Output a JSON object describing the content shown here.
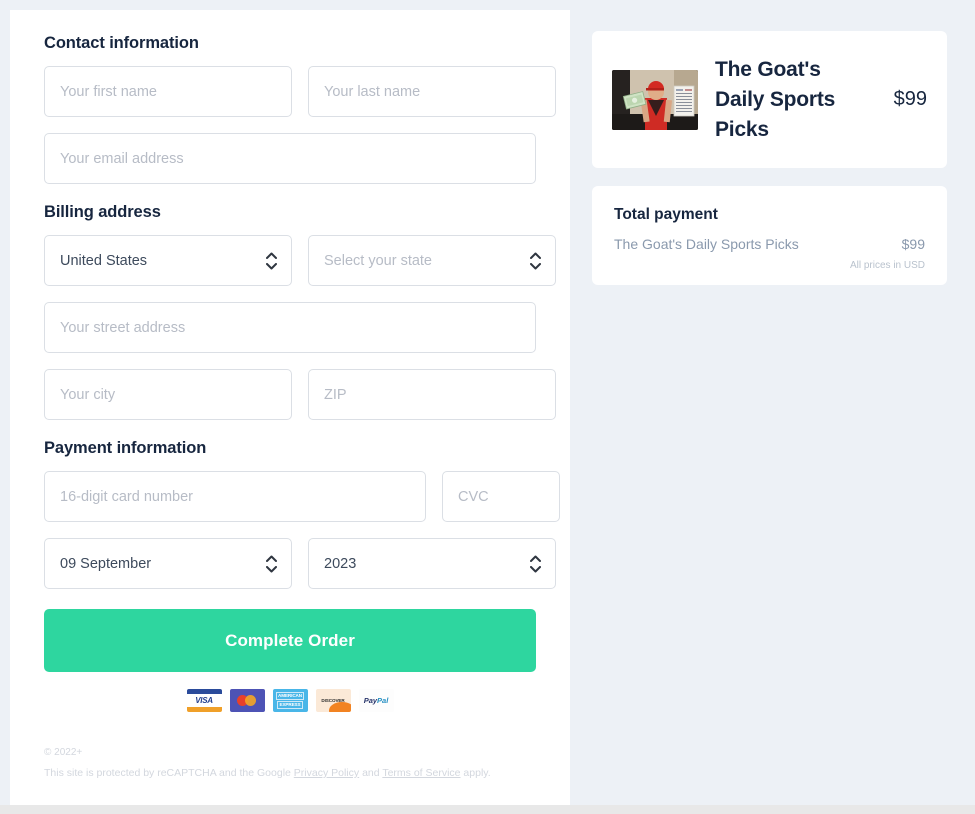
{
  "form": {
    "contact": {
      "heading": "Contact information",
      "first_name_placeholder": "Your first name",
      "last_name_placeholder": "Your last name",
      "email_placeholder": "Your email address"
    },
    "billing": {
      "heading": "Billing address",
      "country_value": "United States",
      "state_value": "Select your state",
      "street_placeholder": "Your street address",
      "city_placeholder": "Your city",
      "zip_placeholder": "ZIP"
    },
    "payment": {
      "heading": "Payment information",
      "card_number_placeholder": "16-digit card number",
      "cvc_placeholder": "CVC",
      "exp_month_value": "09 September",
      "exp_year_value": "2023"
    },
    "submit_label": "Complete Order",
    "accepted_cards": [
      {
        "name": "visa",
        "label": "VISA"
      },
      {
        "name": "mastercard",
        "label": ""
      },
      {
        "name": "amex",
        "label_line1": "AMERICAN",
        "label_line2": "EXPRESS"
      },
      {
        "name": "discover",
        "label": "DISCOVER"
      },
      {
        "name": "paypal",
        "label_pay": "Pay",
        "label_pal": "Pal"
      }
    ]
  },
  "footer": {
    "copyright": "© 2022+",
    "recaptcha_prefix": "This site is protected by reCAPTCHA and the Google ",
    "privacy_link": "Privacy Policy",
    "recaptcha_middle": " and ",
    "terms_link": "Terms of Service",
    "recaptcha_suffix": " apply."
  },
  "sidebar": {
    "product": {
      "title": "The Goat's Daily Sports Picks",
      "price": "$99"
    },
    "total": {
      "heading": "Total payment",
      "line_item_label": "The Goat's Daily Sports Picks",
      "line_item_price": "$99",
      "currency_note": "All prices in USD"
    }
  },
  "colors": {
    "page_background": "#edf1f6",
    "panel_background": "#ffffff",
    "accent_button": "#2ed69f",
    "heading_text": "#17263f",
    "placeholder_text": "#b7bcc6",
    "muted_text": "#8a99ad",
    "field_border": "#dbdfe5"
  }
}
